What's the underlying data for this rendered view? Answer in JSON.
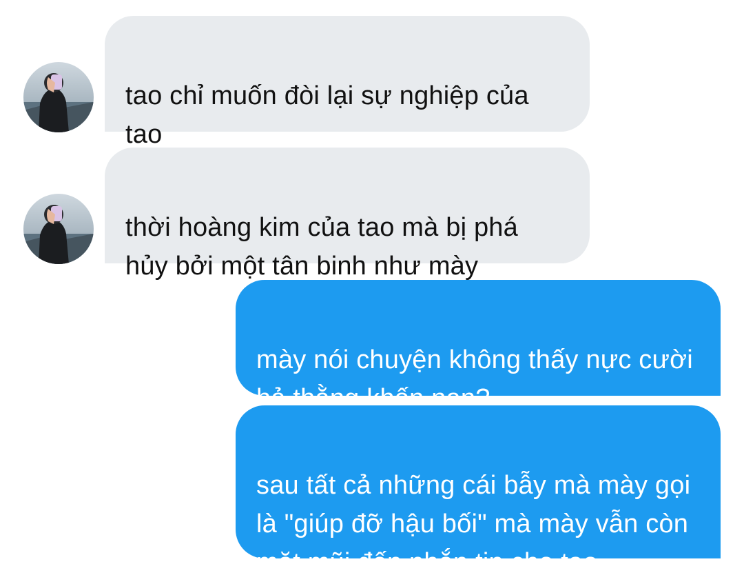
{
  "theme": {
    "received_bg": "#e8ebee",
    "received_fg": "#111111",
    "sent_bg": "#1d9bf0",
    "sent_fg": "#ffffff"
  },
  "messages": [
    {
      "sender": "other",
      "text": "tao chỉ muốn đòi lại sự nghiệp của\ntao",
      "avatar_icon": "user-avatar-photo"
    },
    {
      "sender": "other",
      "text": "thời hoàng kim của tao mà bị phá\nhủy bởi một tân binh như mày",
      "avatar_icon": "user-avatar-photo"
    },
    {
      "sender": "me",
      "text": "mày nói chuyện không thấy nực cười\nhả thằng khốn nạn?"
    },
    {
      "sender": "me",
      "text": "sau tất cả những cái bẫy mà mày gọi\nlà \"giúp đỡ hậu bối\" mà mày vẫn còn\nmặt mũi đến nhắn tin cho tao"
    }
  ]
}
